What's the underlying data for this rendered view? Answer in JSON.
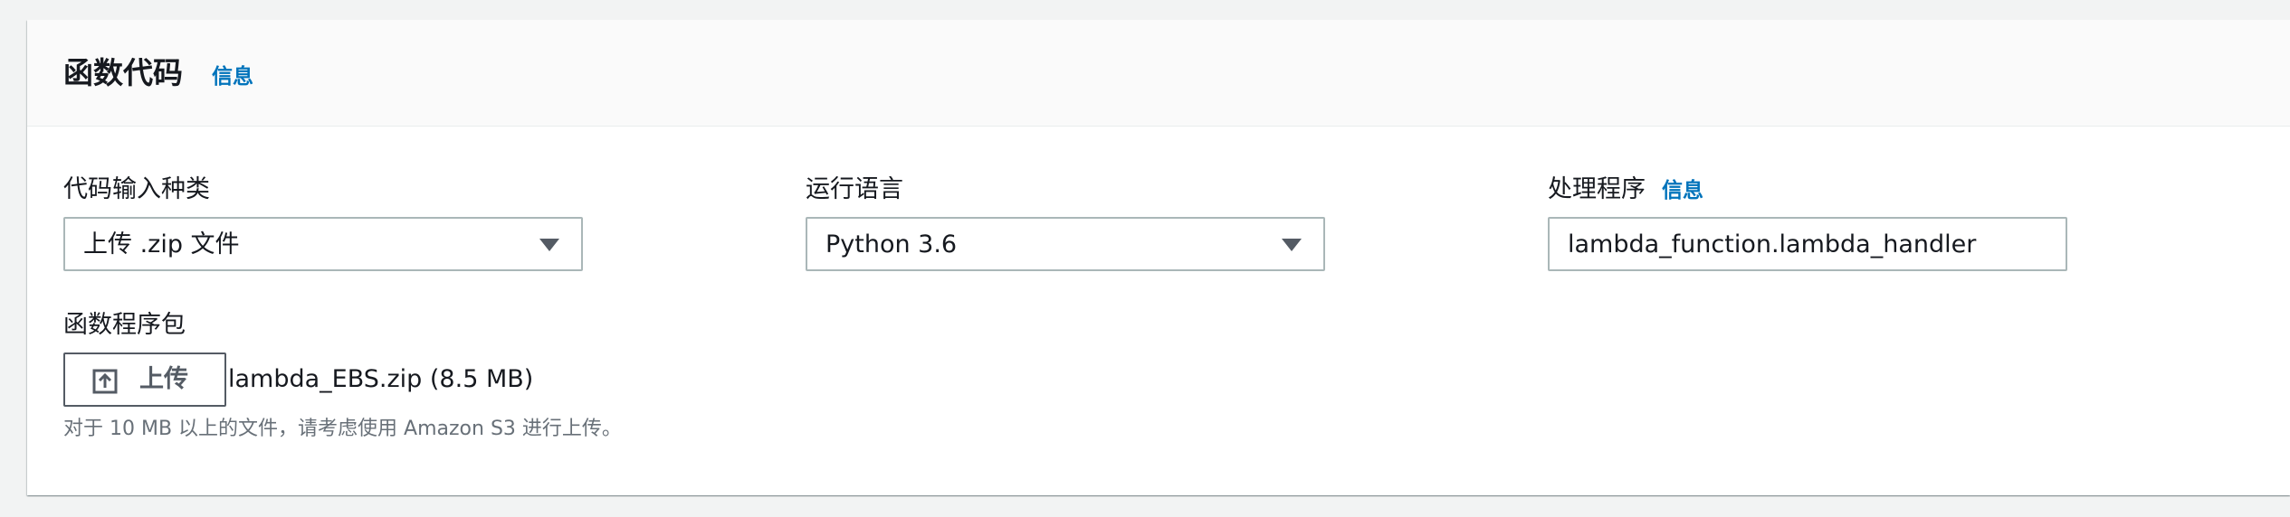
{
  "section": {
    "title": "函数代码",
    "info_label": "信息"
  },
  "code_entry_type": {
    "label": "代码输入种类",
    "value": "上传 .zip 文件"
  },
  "runtime": {
    "label": "运行语言",
    "value": "Python 3.6"
  },
  "handler": {
    "label": "处理程序",
    "info_label": "信息",
    "value": "lambda_function.lambda_handler"
  },
  "function_package": {
    "label": "函数程序包",
    "upload_label": "上传",
    "file_name": "lambda_EBS.zip (8.5 MB)",
    "hint": "对于 10 MB 以上的文件，请考虑使用 Amazon S3 进行上传。"
  },
  "icons": {
    "dropdown": "caret-down-icon",
    "upload": "upload-icon"
  },
  "colors": {
    "link": "#0073bb",
    "text": "#16191f",
    "secondary_text": "#687078",
    "border": "#aab7b8",
    "header_bg": "#fafafa",
    "page_bg": "#f2f3f3"
  }
}
